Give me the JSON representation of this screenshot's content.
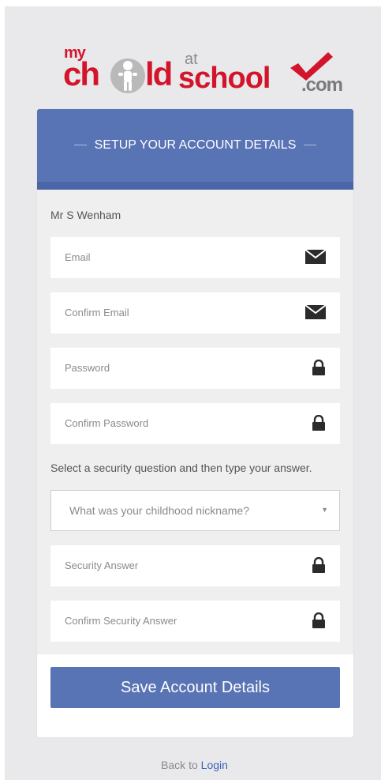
{
  "logo": {
    "my": "my",
    "ch": "ch",
    "ld": "ld",
    "at": "at",
    "school": "school",
    "com": ".com",
    "brand_color": "#d3152b"
  },
  "header": {
    "title": "SETUP YOUR ACCOUNT DETAILS",
    "color": "#5874b5"
  },
  "user": {
    "name": "Mr S Wenham"
  },
  "fields": {
    "email": {
      "placeholder": "Email",
      "icon": "envelope-icon"
    },
    "confirm_email": {
      "placeholder": "Confirm Email",
      "icon": "envelope-icon"
    },
    "password": {
      "placeholder": "Password",
      "icon": "lock-icon"
    },
    "confirm_password": {
      "placeholder": "Confirm Password",
      "icon": "lock-icon"
    },
    "security_answer": {
      "placeholder": "Security Answer",
      "icon": "lock-icon"
    },
    "confirm_security_answer": {
      "placeholder": "Confirm Security Answer",
      "icon": "lock-icon"
    }
  },
  "security": {
    "prompt": "Select a security question and then type your answer.",
    "selected_question": "What was your childhood nickname?"
  },
  "actions": {
    "save_label": "Save Account Details",
    "back_prefix": "Back to",
    "login_link": "Login",
    "link_color": "#3b63b5"
  }
}
